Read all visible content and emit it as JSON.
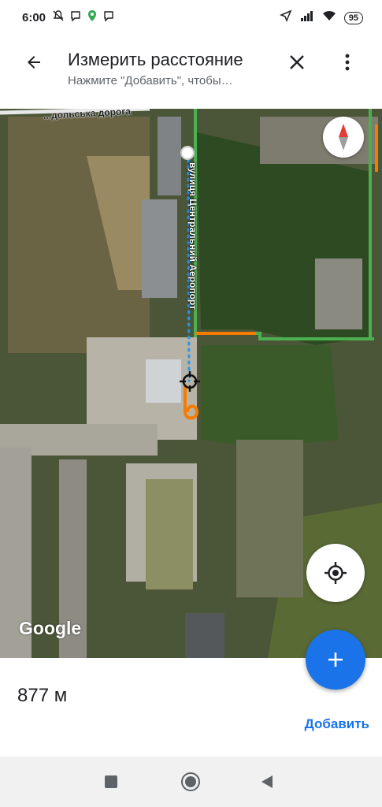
{
  "status_bar": {
    "time": "6:00",
    "battery": "95",
    "left_icons": [
      "muted-notifications-icon",
      "viber-icon",
      "maps-pin-icon",
      "viber-icon"
    ],
    "right_icons": [
      "location-arrow-icon",
      "signal-icon",
      "wifi-icon"
    ]
  },
  "toolbar": {
    "title": "Измерить расстояние",
    "subtitle": "Нажмите \"Добавить\", чтобы…"
  },
  "map": {
    "road_label_top": "...дольська дорога",
    "road_label_vertical": "вулиця Центральний Аеропорт",
    "attribution": "Google",
    "measure_line_color": "#2196f3",
    "traffic_green": "#4caf50",
    "traffic_orange": "#f57c00"
  },
  "measurement": {
    "distance": "877 м",
    "add_label": "Добавить"
  },
  "colors": {
    "accent": "#1a73e8"
  }
}
